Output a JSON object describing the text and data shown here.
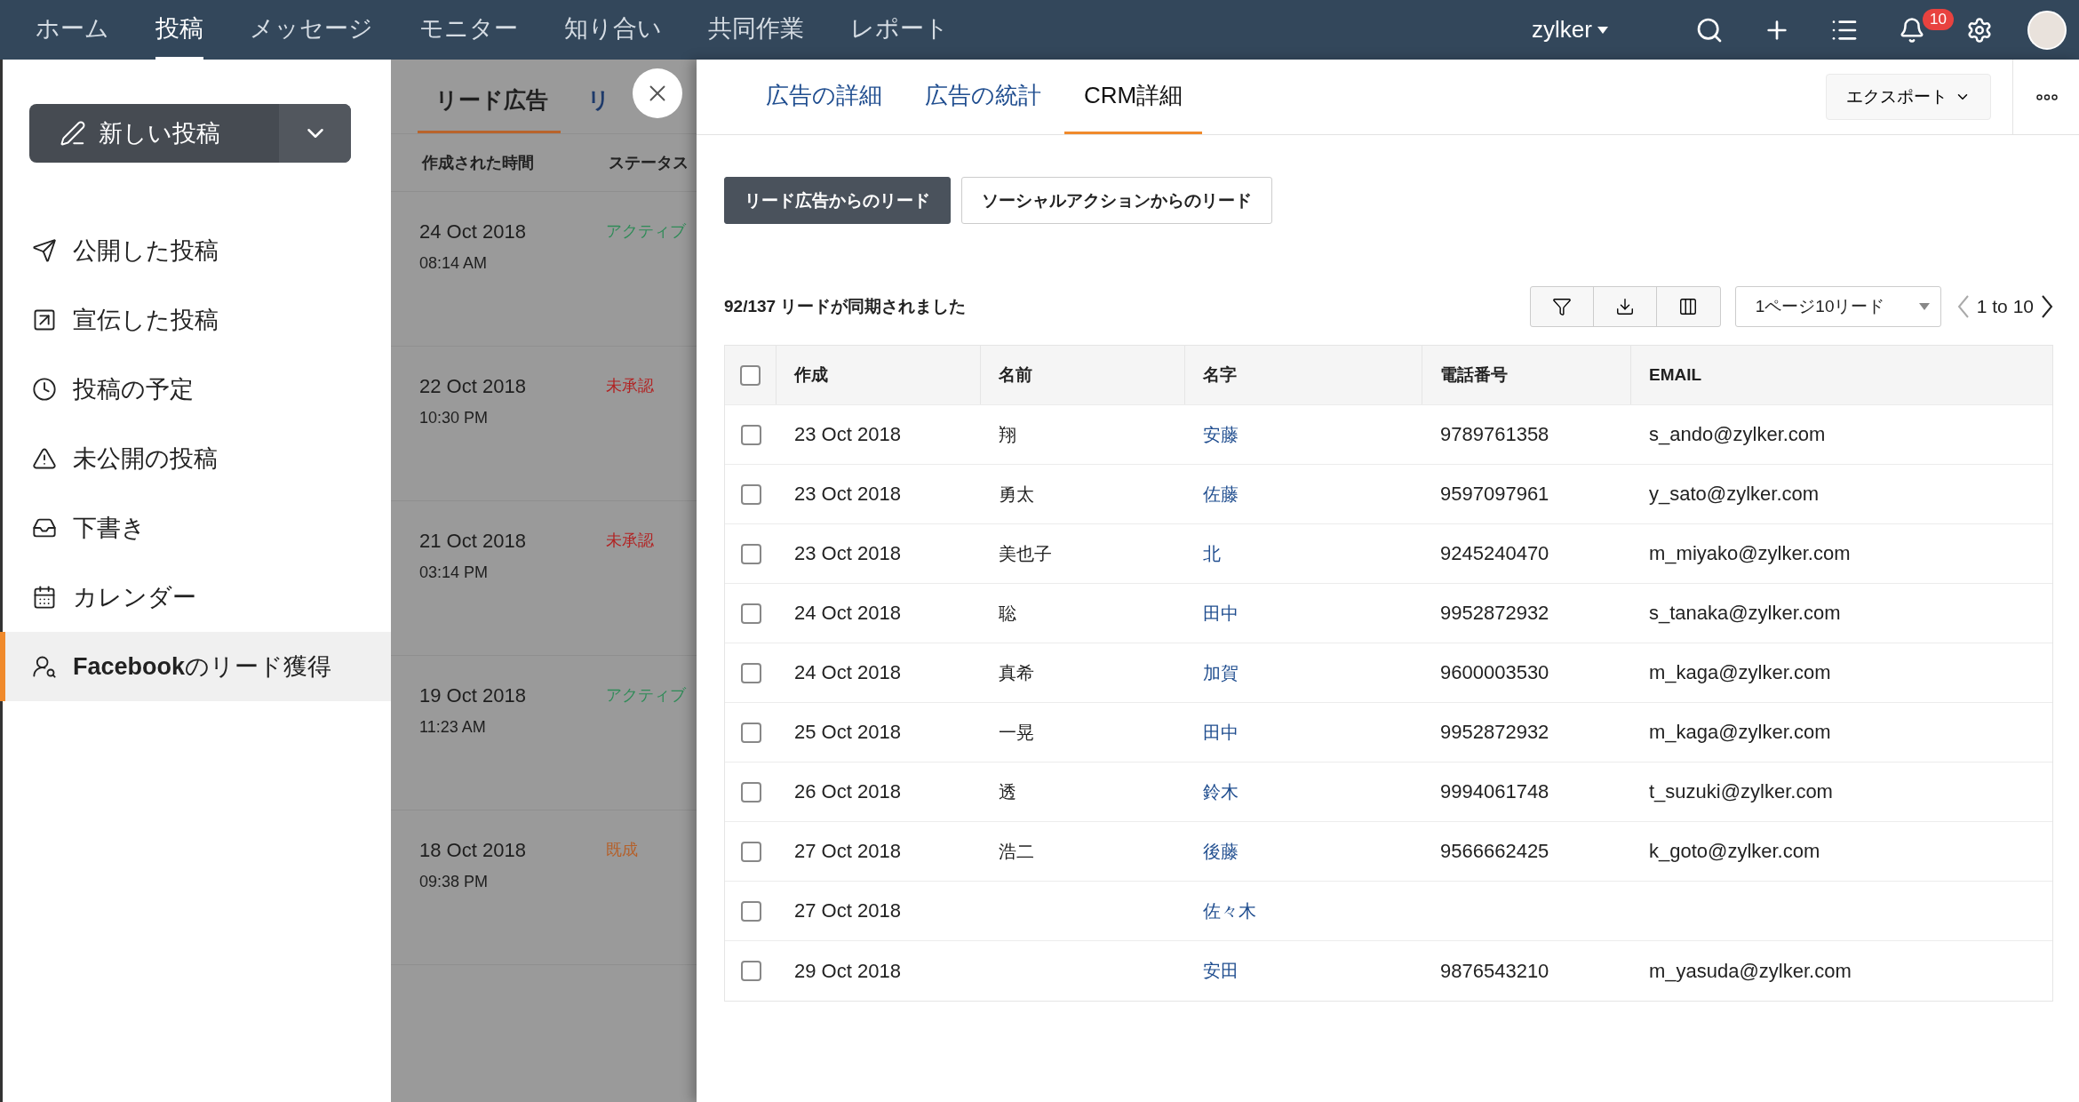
{
  "top_nav": {
    "items": [
      {
        "label": "ホーム",
        "selected": false
      },
      {
        "label": "投稿",
        "selected": true
      },
      {
        "label": "メッセージ",
        "selected": false
      },
      {
        "label": "モニター",
        "selected": false
      },
      {
        "label": "知り合い",
        "selected": false
      },
      {
        "label": "共同作業",
        "selected": false
      },
      {
        "label": "レポート",
        "selected": false
      }
    ],
    "org": "zylker",
    "notification_count": "10"
  },
  "sidebar": {
    "new_post": "新しい投稿",
    "items": [
      {
        "label": "公開した投稿",
        "selected": false
      },
      {
        "label": "宣伝した投稿",
        "selected": false
      },
      {
        "label": "投稿の予定",
        "selected": false
      },
      {
        "label": "未公開の投稿",
        "selected": false
      },
      {
        "label": "下書き",
        "selected": false
      },
      {
        "label": "カレンダー",
        "selected": false
      },
      {
        "label": "**Facebook**のリード獲得",
        "selected": true
      }
    ]
  },
  "ad_list": {
    "tabs": [
      {
        "label": "リード広告",
        "selected": true
      },
      {
        "label": "リ",
        "selected": false
      }
    ],
    "columns": [
      "作成された時間",
      "ステータス"
    ],
    "rows": [
      {
        "date": "24 Oct 2018",
        "time": "08:14 AM",
        "status": "アクティブ",
        "color": "#2e8b57"
      },
      {
        "date": "22 Oct 2018",
        "time": "10:30 PM",
        "status": "未承認",
        "color": "#b22222"
      },
      {
        "date": "21 Oct 2018",
        "time": "03:14 PM",
        "status": "未承認",
        "color": "#b22222"
      },
      {
        "date": "19 Oct 2018",
        "time": "11:23 AM",
        "status": "アクティブ",
        "color": "#2e8b57"
      },
      {
        "date": "18 Oct 2018",
        "time": "09:38 PM",
        "status": "既成",
        "color": "#b5602a"
      }
    ]
  },
  "detail": {
    "tabs": [
      {
        "label": "広告の詳細",
        "selected": false
      },
      {
        "label": "広告の統計",
        "selected": false
      },
      {
        "label": "CRM詳細",
        "selected": true
      }
    ],
    "export": "エクスポート",
    "lead_sources": [
      {
        "label": "リード広告からのリード",
        "selected": true
      },
      {
        "label": "ソーシャルアクションからのリード",
        "selected": false
      }
    ],
    "sync_text": "92/137 リードが同期されました",
    "page_size": "1ページ10リード",
    "range": "1 to 10",
    "table": {
      "header_checked": false,
      "columns": [
        "作成",
        "名前",
        "名字",
        "電話番号",
        "EMAIL"
      ],
      "rows": [
        {
          "checked": false,
          "created": "23 Oct 2018",
          "first_name": "翔",
          "last_name": "安藤",
          "phone": "9789761358",
          "email": "s_ando@zylker.com"
        },
        {
          "checked": false,
          "created": "23 Oct 2018",
          "first_name": "勇太",
          "last_name": "佐藤",
          "phone": "9597097961",
          "email": "y_sato@zylker.com"
        },
        {
          "checked": false,
          "created": "23 Oct 2018",
          "first_name": "美也子",
          "last_name": "北",
          "phone": "9245240470",
          "email": "m_miyako@zylker.com"
        },
        {
          "checked": false,
          "created": "24 Oct 2018",
          "first_name": "聡",
          "last_name": "田中",
          "phone": "9952872932",
          "email": "s_tanaka@zylker.com"
        },
        {
          "checked": false,
          "created": "24 Oct 2018",
          "first_name": "真希",
          "last_name": "加賀",
          "phone": "9600003530",
          "email": "m_kaga@zylker.com"
        },
        {
          "checked": false,
          "created": "25 Oct 2018",
          "first_name": "一晃",
          "last_name": "田中",
          "phone": "9952872932",
          "email": "m_kaga@zylker.com"
        },
        {
          "checked": false,
          "created": "26 Oct 2018",
          "first_name": "透",
          "last_name": "鈴木",
          "phone": "9994061748",
          "email": "t_suzuki@zylker.com"
        },
        {
          "checked": false,
          "created": "27 Oct 2018",
          "first_name": "浩二",
          "last_name": "後藤",
          "phone": "9566662425",
          "email": "k_goto@zylker.com"
        },
        {
          "checked": false,
          "created": "27 Oct 2018",
          "last_name": "佐々木"
        },
        {
          "checked": false,
          "created": "29 Oct 2018",
          "last_name": "安田",
          "phone": "9876543210",
          "email": "m_yasuda@zylker.com"
        }
      ]
    }
  }
}
